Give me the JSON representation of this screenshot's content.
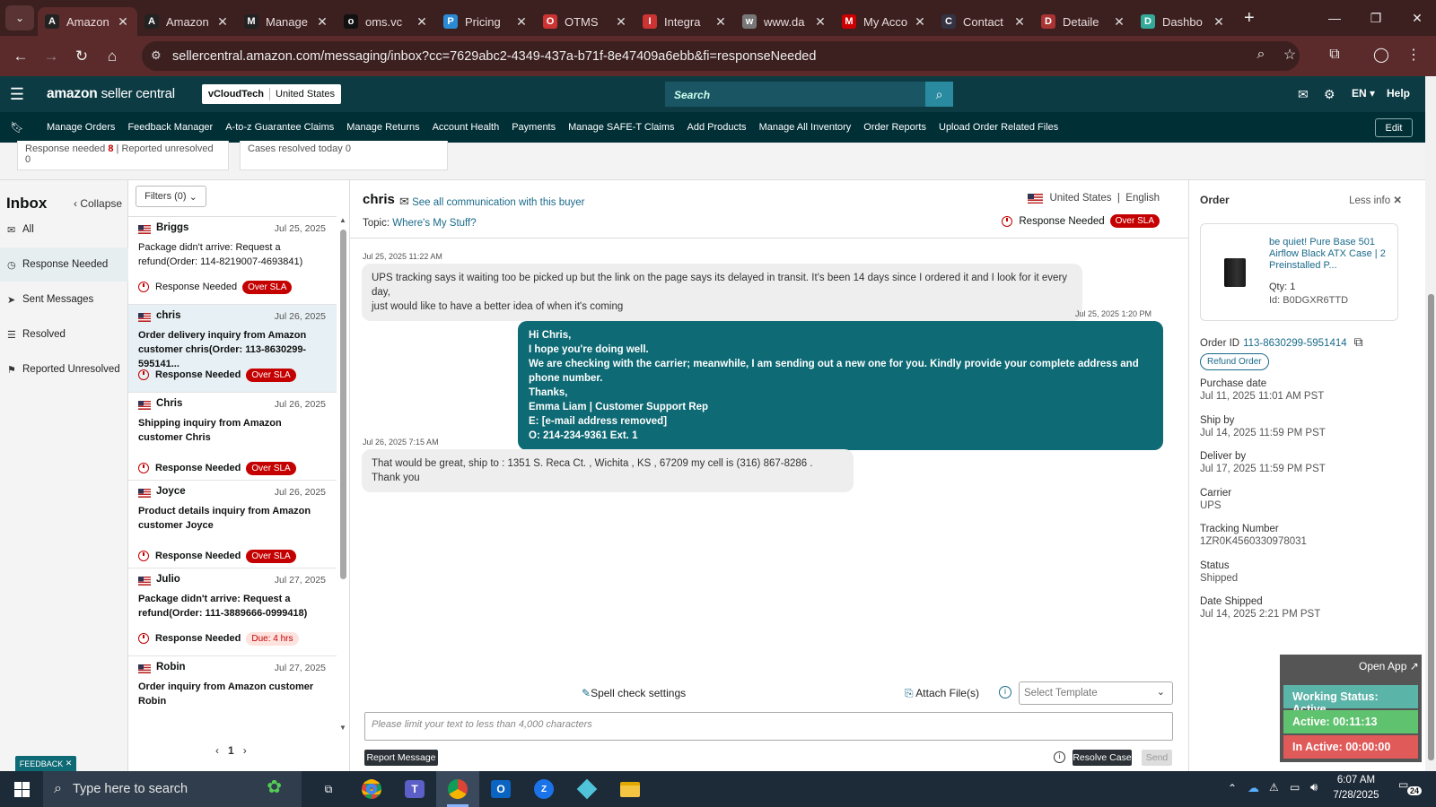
{
  "browser": {
    "tabs": [
      {
        "title": "Amazon",
        "icon": "amazon-icon",
        "color": "#222"
      },
      {
        "title": "Amazon",
        "icon": "amazon-icon",
        "color": "#222"
      },
      {
        "title": "Manage",
        "icon": "amazon-icon",
        "color": "#222"
      },
      {
        "title": "oms.vc",
        "icon": "oms-icon",
        "color": "#111"
      },
      {
        "title": "Pricing",
        "icon": "dollar-icon",
        "color": "#2a8ad4"
      },
      {
        "title": "OTMS",
        "icon": "otms-icon",
        "color": "#c33"
      },
      {
        "title": "Integra",
        "icon": "integration-icon",
        "color": "#c33"
      },
      {
        "title": "www.da",
        "icon": "globe-icon",
        "color": "#777"
      },
      {
        "title": "My Acco",
        "icon": "account-icon",
        "color": "#c00"
      },
      {
        "title": "Contact",
        "icon": "mail-icon",
        "color": "#334"
      },
      {
        "title": "Detaile",
        "icon": "flag-icon",
        "color": "#a33"
      },
      {
        "title": "Dashbo",
        "icon": "dashboard-icon",
        "color": "#3a9"
      }
    ],
    "url": "sellercentral.amazon.com/messaging/inbox?cc=7629abc2-4349-437a-b71f-8e47409a6ebb&fi=responseNeeded"
  },
  "header": {
    "logo_main": "amazon",
    "logo_sub": "seller central",
    "store": "vCloudTech",
    "marketplace": "United States",
    "search_placeholder": "Search",
    "lang": "EN",
    "help": "Help"
  },
  "nav": {
    "items": [
      "Manage Orders",
      "Feedback Manager",
      "A-to-z Guarantee Claims",
      "Manage Returns",
      "Account Health",
      "Payments",
      "Manage SAFE-T Claims",
      "Add Products",
      "Manage All Inventory",
      "Order Reports",
      "Upload Order Related Files"
    ],
    "edit": "Edit"
  },
  "summary": {
    "response_needed_label": "Response needed",
    "response_needed_count": "8",
    "reported_unresolved": "Reported unresolved 0",
    "cases_resolved": "Cases resolved today 0"
  },
  "sidebar": {
    "title": "Inbox",
    "collapse": "Collapse",
    "items": [
      {
        "label": "All",
        "icon": "mail-icon"
      },
      {
        "label": "Response Needed",
        "icon": "clock-icon"
      },
      {
        "label": "Sent Messages",
        "icon": "send-icon"
      },
      {
        "label": "Resolved",
        "icon": "check-list-icon"
      },
      {
        "label": "Reported Unresolved",
        "icon": "report-user-icon"
      }
    ]
  },
  "list": {
    "filters": "Filters (0)",
    "page": "1",
    "conversations": [
      {
        "name": "Briggs",
        "date": "Jul 25, 2025",
        "subject": "Package didn't arrive: Request a refund(Order: 114-8219007-4693841)",
        "status": "Response Needed",
        "badge": "Over SLA",
        "bold": false,
        "selected": false
      },
      {
        "name": "chris",
        "date": "Jul 26, 2025",
        "subject": "Order delivery inquiry from Amazon customer chris(Order: 113-8630299-595141...",
        "status": "Response Needed",
        "badge": "Over SLA",
        "bold": true,
        "selected": true
      },
      {
        "name": "Chris",
        "date": "Jul 26, 2025",
        "subject": "Shipping inquiry from Amazon customer Chris",
        "status": "Response Needed",
        "badge": "Over SLA",
        "bold": true,
        "selected": false
      },
      {
        "name": "Joyce",
        "date": "Jul 26, 2025",
        "subject": "Product details inquiry from Amazon customer Joyce",
        "status": "Response Needed",
        "badge": "Over SLA",
        "bold": true,
        "selected": false
      },
      {
        "name": "Julio",
        "date": "Jul 27, 2025",
        "subject": "Package didn't arrive: Request a refund(Order: 111-3889666-0999418)",
        "status": "Response Needed",
        "badge": "Due: 4 hrs",
        "bold": true,
        "selected": false
      },
      {
        "name": "Robin",
        "date": "Jul 27, 2025",
        "subject": "Order inquiry from Amazon customer Robin",
        "status": "",
        "badge": "",
        "bold": true,
        "selected": false
      }
    ]
  },
  "thread": {
    "buyer": "chris",
    "see_all": "See all communication with this buyer",
    "topic_label": "Topic:",
    "topic": "Where's My Stuff?",
    "country": "United States",
    "language": "English",
    "status": "Response Needed",
    "badge": "Over SLA",
    "messages": [
      {
        "dir": "in",
        "time": "Jul 25, 2025 11:22 AM",
        "lines": [
          "UPS tracking says it waiting too be picked up but the link on the page says its delayed in transit. It's been 14 days since I ordered it and I look for it every day,",
          "just would like to have a better idea of when it's coming"
        ]
      },
      {
        "dir": "out",
        "time": "Jul 25, 2025 1:20 PM",
        "lines": [
          "Hi Chris,",
          "I hope you're doing well.",
          "We are checking with the carrier; meanwhile, I am sending out a new one for you. Kindly provide your complete address and phone number.",
          "Thanks,",
          "Emma Liam | Customer Support Rep",
          "E: [e-mail address removed]",
          "O: 214-234-9361 Ext. 1"
        ]
      },
      {
        "dir": "in",
        "time": "Jul 26, 2025 7:15 AM",
        "lines": [
          "That would be great, ship to : 1351 S. Reca Ct. , Wichita , KS , 67209 my cell is (316) 867-8286 . Thank you"
        ]
      }
    ],
    "spell_check": "Spell check settings",
    "attach": "Attach File(s)",
    "template_placeholder": "Select Template",
    "textbox_placeholder": "Please limit your text to less than 4,000 characters",
    "report": "Report Message",
    "resolve": "Resolve Case",
    "send": "Send"
  },
  "order": {
    "title": "Order",
    "less_info": "Less info",
    "product_name": "be quiet! Pure Base 501 Airflow Black ATX Case | 2 Preinstalled P...",
    "qty": "Qty: 1",
    "id": "Id: B0DGXR6TTD",
    "order_id_label": "Order ID",
    "order_id": "113-8630299-5951414",
    "refund": "Refund Order",
    "fields": [
      {
        "label": "Purchase date",
        "value": "Jul 11, 2025 11:01 AM PST"
      },
      {
        "label": "Ship by",
        "value": "Jul 14, 2025 11:59 PM PST"
      },
      {
        "label": "Deliver by",
        "value": "Jul 17, 2025 11:59 PM PST"
      },
      {
        "label": "Carrier",
        "value": "UPS"
      },
      {
        "label": "Tracking Number",
        "value": "1ZR0K4560330978031"
      },
      {
        "label": "Status",
        "value": "Shipped"
      },
      {
        "label": "Date Shipped",
        "value": "Jul 14, 2025 2:21 PM PST"
      }
    ]
  },
  "tracker": {
    "open_app": "Open App ↗",
    "working": "Working Status: Active",
    "active": "Active: 00:11:13",
    "inactive": "In Active: 00:00:00",
    "colors": {
      "working": "#5bb4a8",
      "active": "#5fc26e",
      "inactive": "#e05a5a"
    }
  },
  "feedback": "FEEDBACK",
  "taskbar": {
    "search": "Type here to search",
    "time": "6:07 AM",
    "date": "7/28/2025",
    "notif_count": "24"
  }
}
